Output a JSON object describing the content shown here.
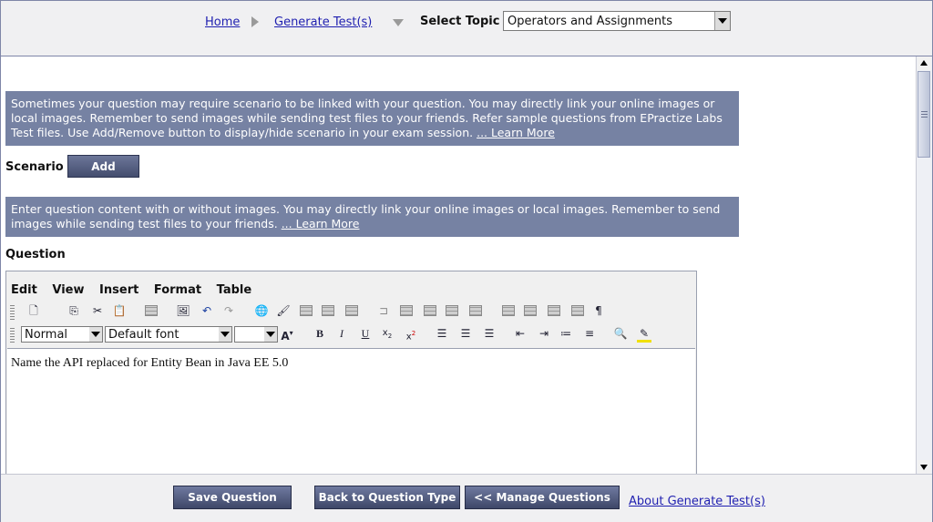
{
  "header": {
    "home_link": "Home",
    "generate_link": "Generate Test(s)",
    "select_topic_label": "Select Topic",
    "topic_value": "Operators and Assignments"
  },
  "scenario_info": {
    "text": "Sometimes your question may require scenario to be linked with your question. You may directly link your online images or local images. Remember to send images while sending test files to your friends. Refer sample questions from EPractize Labs Test files. Use Add/Remove button to display/hide scenario in your exam session.",
    "learn_more": "... Learn More"
  },
  "scenario": {
    "label": "Scenario",
    "add_button": "Add"
  },
  "question_info": {
    "text": "Enter question content with or without images. You may directly link your online images or local images. Remember to send images while sending test files to your friends.",
    "learn_more": "... Learn More"
  },
  "question": {
    "label": "Question"
  },
  "editor": {
    "menu": [
      "Edit",
      "View",
      "Insert",
      "Format",
      "Table"
    ],
    "style_value": "Normal",
    "font_value": "Default font",
    "size_value": "",
    "content": "Name the API replaced for Entity Bean in Java EE 5.0"
  },
  "footer": {
    "save_button": "Save Question",
    "back_button": "Back to Question Type",
    "manage_button": "<< Manage Questions",
    "about_link": "About Generate Test(s)"
  }
}
